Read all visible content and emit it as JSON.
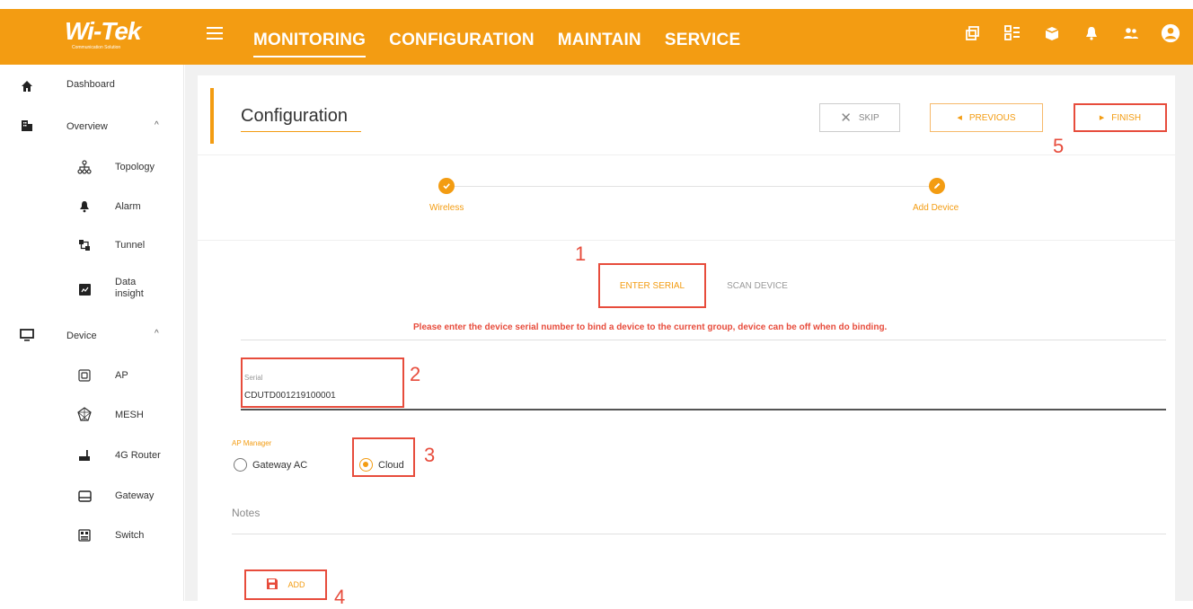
{
  "header": {
    "logo": "Wi-Tek",
    "logo_sub": "Communication Solution",
    "nav": [
      {
        "label": "MONITORING"
      },
      {
        "label": "CONFIGURATION"
      },
      {
        "label": "MAINTAIN"
      },
      {
        "label": "SERVICE"
      }
    ],
    "icons": [
      "copy-icon",
      "apps-grid-icon",
      "box-icon",
      "bell-icon",
      "users-icon",
      "account-icon"
    ]
  },
  "sidebar": {
    "dashboard": "Dashboard",
    "overview": "Overview",
    "overview_items": [
      "Topology",
      "Alarm",
      "Tunnel",
      "Data insight"
    ],
    "device": "Device",
    "device_items": [
      "AP",
      "MESH",
      "4G Router",
      "Gateway",
      "Switch"
    ]
  },
  "page": {
    "title": "Configuration",
    "buttons": {
      "skip": "SKIP",
      "previous": "PREVIOUS",
      "finish": "FINISH"
    },
    "steps": [
      {
        "label": "Wireless"
      },
      {
        "label": "Add Device"
      }
    ],
    "tabs": {
      "enter_serial": "ENTER SERIAL",
      "scan_device": "SCAN DEVICE"
    },
    "hint": "Please enter the device serial number to bind a device to the current group, device can be off when do binding.",
    "serial": {
      "label": "Serial",
      "value": "CDUTD001219100001"
    },
    "ap_manager": {
      "label": "AP Manager",
      "options": [
        "Gateway AC",
        "Cloud"
      ],
      "selected": "Cloud"
    },
    "notes_label": "Notes",
    "add_button": "ADD"
  },
  "annotations": [
    "1",
    "2",
    "3",
    "4",
    "5"
  ],
  "colors": {
    "brand": "#f39c12",
    "annotation_red": "#e74c3c"
  }
}
